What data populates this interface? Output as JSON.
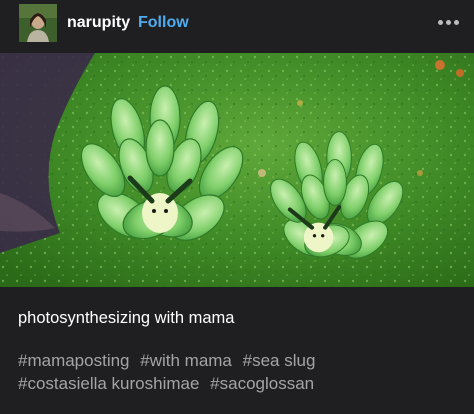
{
  "post": {
    "username": "narupity",
    "follow_label": "Follow",
    "more_icon": "more-options-icon",
    "caption": "photosynthesizing with mama",
    "tags": [
      "#mamaposting",
      "#with mama",
      "#sea slug",
      "#costasiella kuroshimae",
      "#sacoglossan"
    ]
  },
  "colors": {
    "background": "#1f1f21",
    "follow": "#4eacf0",
    "tag_text": "#a4a4a8"
  }
}
